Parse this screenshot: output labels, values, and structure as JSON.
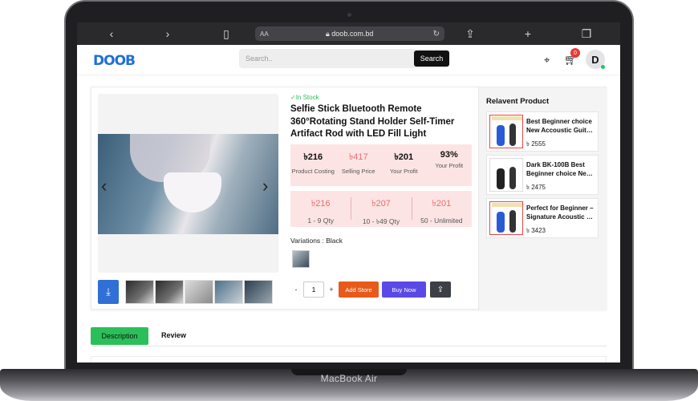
{
  "device": {
    "label": "MacBook Air"
  },
  "browser": {
    "address_prefix": "AA",
    "url": "doob.com.bd",
    "icons": [
      "back-icon",
      "forward-icon",
      "book-icon",
      "lock-icon",
      "reload-icon",
      "share-icon",
      "plus-icon",
      "tabs-icon"
    ]
  },
  "header": {
    "logo": "DOOB",
    "search_placeholder": "Search..",
    "search_button": "Search",
    "cart_count": "0",
    "avatar_initial": "D",
    "accent_color": "#1f6fd8"
  },
  "product": {
    "stock": "✓In Stock",
    "title": "Selfie Stick Bluetooth Remote 360°Rotating Stand Holder Self-Timer Artifact Rod with LED Fill Light",
    "prices": [
      {
        "value": "৳216",
        "label": "Product Costing"
      },
      {
        "value": "৳417",
        "label": "Selling Price"
      },
      {
        "value": "৳201",
        "label": "Your Profit"
      },
      {
        "value": "93%",
        "label": "Your Profit"
      }
    ],
    "tiers": [
      {
        "value": "৳216",
        "label": "1 - 9 Qty"
      },
      {
        "value": "৳207",
        "label": "10 - ৳49 Qty"
      },
      {
        "value": "৳201",
        "label": "50 - Unlimited"
      }
    ],
    "variations_label": "Variations : Black",
    "quantity": "1",
    "qty_minus": "-",
    "qty_plus": "+",
    "add_store": "Add Store",
    "buy_now": "Buy Now"
  },
  "related": {
    "heading": "Relavent Product",
    "items": [
      {
        "name": "Best Beginner choice New Accoustic Guit…",
        "price": "৳ 2555"
      },
      {
        "name": "Dark BK-100B Best Beginner choice Ne…",
        "price": "৳ 2475"
      },
      {
        "name": "Perfect for Beginner – Signature Acoustic …",
        "price": "৳ 3423"
      }
    ]
  },
  "tabs": {
    "description": "Description",
    "review": "Review",
    "active_color": "#2bbf5a"
  }
}
